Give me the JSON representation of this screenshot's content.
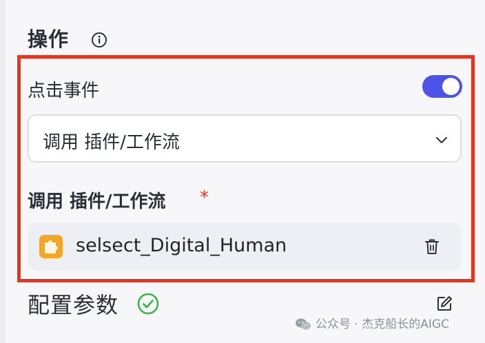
{
  "action_section": {
    "title": "操作",
    "click_event_label": "点击事件",
    "click_event_enabled": true,
    "action_select_value": "调用 插件/工作流",
    "plugin_field_label": "调用 插件/工作流",
    "required_mark": "*",
    "selected_plugin": "selsect_Digital_Human"
  },
  "config_section": {
    "title": "配置参数"
  },
  "watermark": {
    "text": "公众号 · 杰克船长的AIGC"
  },
  "colors": {
    "accent": "#4d53e8",
    "highlight": "#e8331f",
    "success": "#3bb54a",
    "plugin_icon": "#f5a623"
  },
  "icons": {
    "info": "info-circle-icon",
    "chevron": "chevron-down-icon",
    "plugin": "puzzle-icon",
    "delete": "trash-icon",
    "status": "check-circle-icon",
    "edit": "edit-icon"
  }
}
